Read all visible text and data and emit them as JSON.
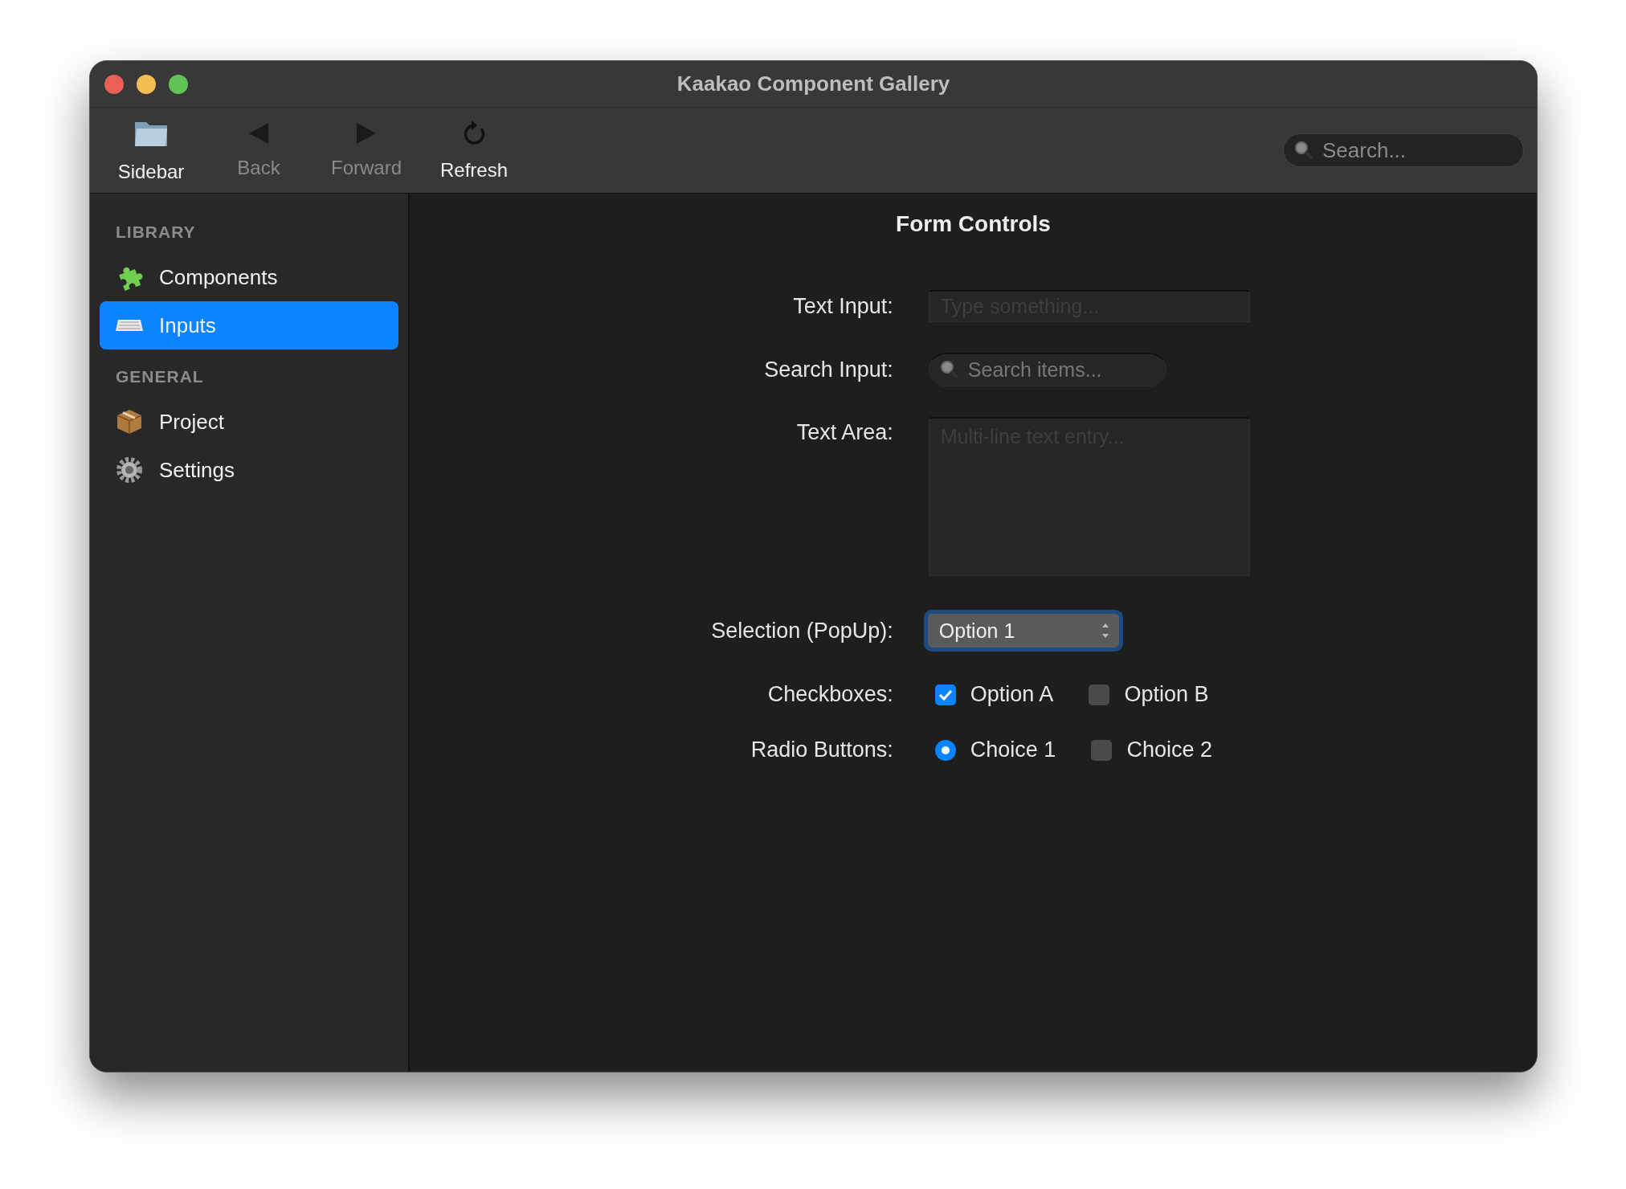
{
  "window": {
    "title": "Kaakao Component Gallery"
  },
  "toolbar": {
    "items": [
      {
        "label": "Sidebar",
        "kind": "sidebar",
        "disabled": false
      },
      {
        "label": "Back",
        "kind": "back",
        "disabled": true
      },
      {
        "label": "Forward",
        "kind": "forward",
        "disabled": true
      },
      {
        "label": "Refresh",
        "kind": "refresh",
        "disabled": false
      }
    ],
    "search": {
      "placeholder": "Search..."
    }
  },
  "sidebar": {
    "sections": [
      {
        "heading": "LIBRARY",
        "items": [
          {
            "label": "Components",
            "kind": "puzzle",
            "selected": false
          },
          {
            "label": "Inputs",
            "kind": "keyboard",
            "selected": true
          }
        ]
      },
      {
        "heading": "GENERAL",
        "items": [
          {
            "label": "Project",
            "kind": "box",
            "selected": false
          },
          {
            "label": "Settings",
            "kind": "gear",
            "selected": false
          }
        ]
      }
    ]
  },
  "form": {
    "title": "Form Controls",
    "rows": [
      {
        "label": "Text Input:",
        "kind": "text",
        "placeholder": "Type something..."
      },
      {
        "label": "Search Input:",
        "kind": "search",
        "placeholder": "Search items..."
      },
      {
        "label": "Text Area:",
        "kind": "textarea",
        "placeholder": "Multi-line text entry..."
      },
      {
        "label": "Selection (PopUp):",
        "kind": "popup",
        "value": "Option 1",
        "focused": true
      },
      {
        "label": "Checkboxes:",
        "kind": "checkboxes",
        "options": [
          {
            "label": "Option A",
            "checked": true
          },
          {
            "label": "Option B",
            "checked": false
          }
        ]
      },
      {
        "label": "Radio Buttons:",
        "kind": "radios",
        "options": [
          {
            "label": "Choice 1",
            "selected": true
          },
          {
            "label": "Choice 2",
            "selected": false
          }
        ]
      }
    ]
  }
}
